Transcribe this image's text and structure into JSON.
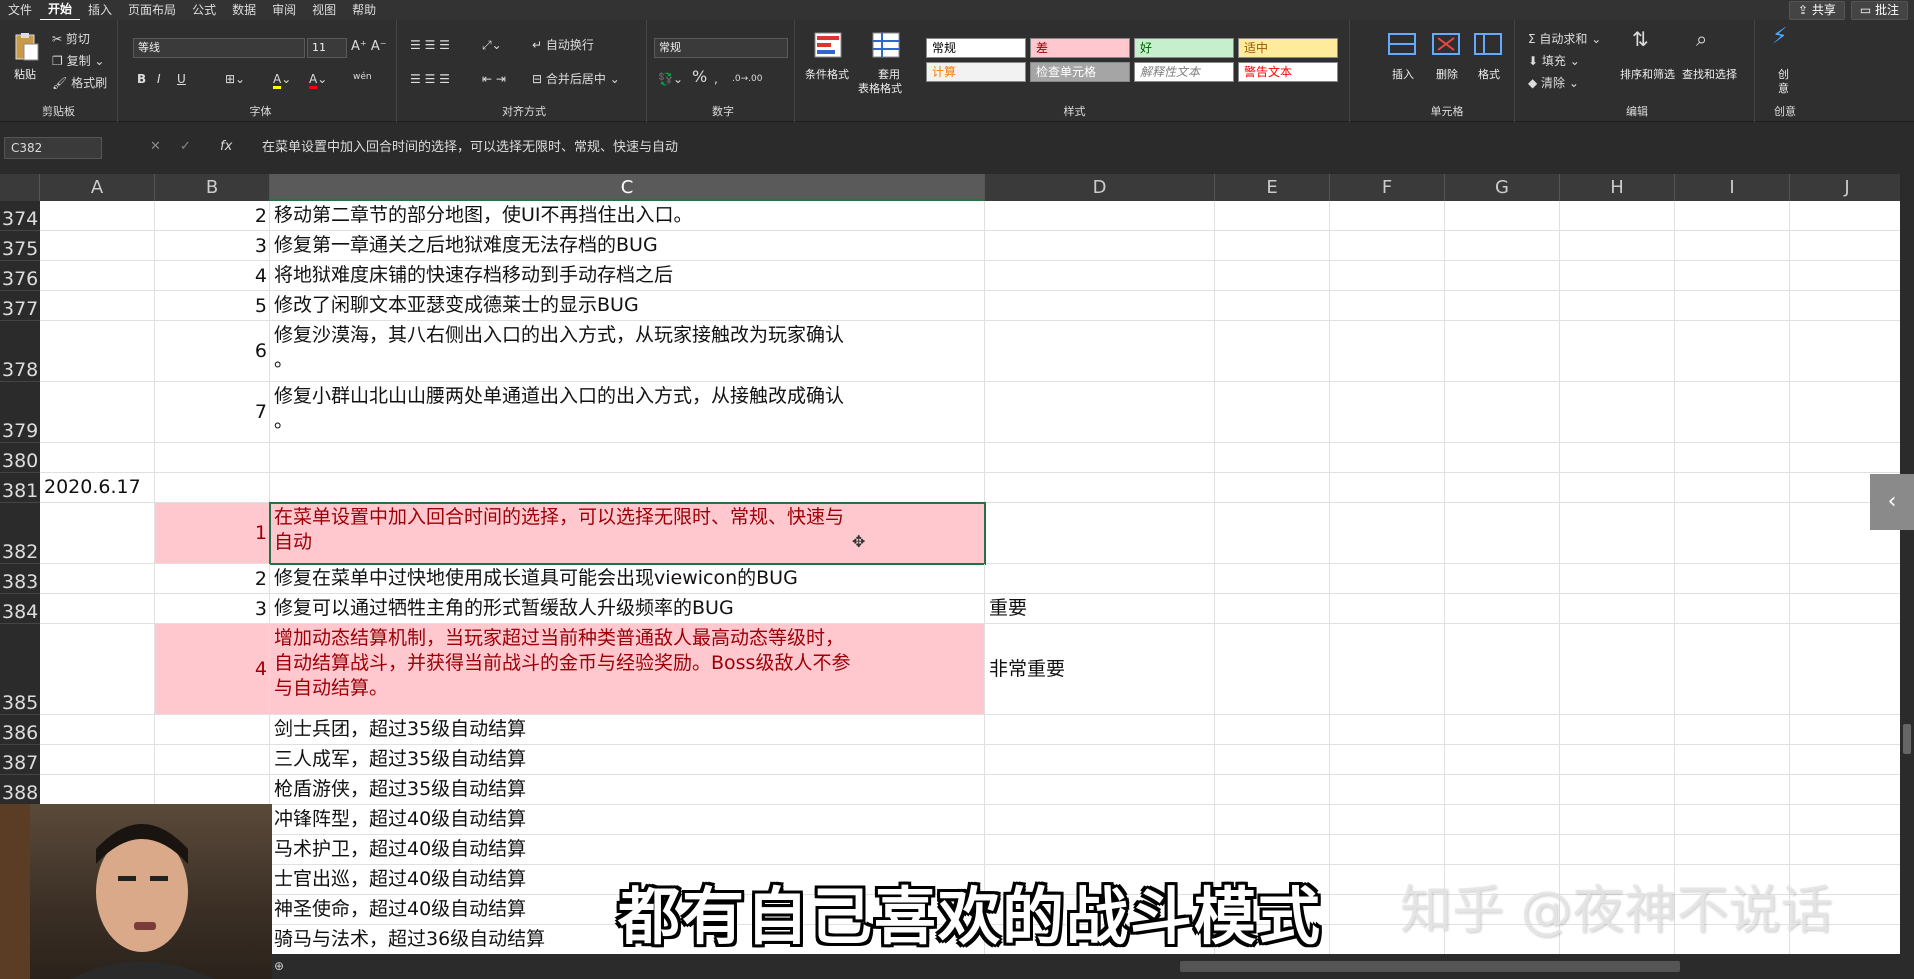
{
  "menu": {
    "tabs": [
      "文件",
      "开始",
      "插入",
      "页面布局",
      "公式",
      "数据",
      "审阅",
      "视图",
      "帮助"
    ],
    "active_index": 1,
    "share_label": "共享",
    "comments_label": "批注"
  },
  "ribbon": {
    "clipboard": {
      "paste": "粘贴",
      "cut": "剪切",
      "copy": "复制",
      "format_painter": "格式刷",
      "group": "剪贴板"
    },
    "font": {
      "name": "等线",
      "size": "11",
      "group": "字体",
      "bold": "B",
      "italic": "I",
      "underline": "U",
      "phonetic": "wén"
    },
    "alignment": {
      "wrap": "自动换行",
      "merge": "合并后居中",
      "group": "对齐方式"
    },
    "number": {
      "format": "常规",
      "percent": "%",
      "group": "数字"
    },
    "styles": {
      "conditional": "条件格式",
      "table": "套用",
      "table2": "表格格式",
      "cells": [
        {
          "label": "常规",
          "bg": "#ffffff",
          "fg": "#000000"
        },
        {
          "label": "差",
          "bg": "#ffc7ce",
          "fg": "#9c0006"
        },
        {
          "label": "好",
          "bg": "#c6efce",
          "fg": "#006100"
        },
        {
          "label": "适中",
          "bg": "#ffeb9c",
          "fg": "#9c5700"
        },
        {
          "label": "计算",
          "bg": "#f2f2f2",
          "fg": "#fa7d00"
        },
        {
          "label": "检查单元格",
          "bg": "#a5a5a5",
          "fg": "#ffffff"
        },
        {
          "label": "解释性文本",
          "bg": "#ffffff",
          "fg": "#7f7f7f"
        },
        {
          "label": "警告文本",
          "bg": "#ffffff",
          "fg": "#ff0000"
        }
      ],
      "group": "样式"
    },
    "cells": {
      "insert": "插入",
      "delete": "删除",
      "format": "格式",
      "group": "单元格"
    },
    "editing": {
      "autosum": "自动求和",
      "fill": "填充",
      "clear": "清除",
      "sort": "排序和筛选",
      "find": "查找和选择",
      "group": "编辑"
    },
    "create": {
      "label1": "创",
      "label2": "意",
      "group": "创意"
    }
  },
  "formula_bar": {
    "name_box": "C382",
    "fx": "fx",
    "content": "在菜单设置中加入回合时间的选择，可以选择无限时、常规、快速与自动"
  },
  "grid": {
    "columns": [
      "A",
      "B",
      "C",
      "D",
      "E",
      "F",
      "G",
      "H",
      "I",
      "J"
    ],
    "selected_column": "C",
    "rows": [
      {
        "num": "374",
        "a": "",
        "b": "2",
        "c": [
          "移动第二章节的部分地图，使UI不再挡住出入口。"
        ],
        "d": "",
        "pink": false
      },
      {
        "num": "375",
        "a": "",
        "b": "3",
        "c": [
          "修复第一章通关之后地狱难度无法存档的BUG"
        ],
        "d": "",
        "pink": false
      },
      {
        "num": "376",
        "a": "",
        "b": "4",
        "c": [
          "将地狱难度床铺的快速存档移动到手动存档之后"
        ],
        "d": "",
        "pink": false
      },
      {
        "num": "377",
        "a": "",
        "b": "5",
        "c": [
          "修改了闲聊文本亚瑟变成德莱士的显示BUG"
        ],
        "d": "",
        "pink": false
      },
      {
        "num": "378",
        "a": "",
        "b": "6",
        "c": [
          "修复沙漠海，其八右侧出入口的出入方式，从玩家接触改为玩家确认",
          "。"
        ],
        "d": "",
        "pink": false
      },
      {
        "num": "379",
        "a": "",
        "b": "7",
        "c": [
          "修复小群山北山山腰两处单通道出入口的出入方式，从接触改成确认",
          "。"
        ],
        "d": "",
        "pink": false
      },
      {
        "num": "380",
        "a": "",
        "b": "",
        "c": [],
        "d": "",
        "pink": false
      },
      {
        "num": "381",
        "a": "2020.6.17",
        "b": "",
        "c": [],
        "d": "",
        "pink": false
      },
      {
        "num": "382",
        "a": "",
        "b": "1",
        "c": [
          "在菜单设置中加入回合时间的选择，可以选择无限时、常规、快速与",
          "自动"
        ],
        "d": "",
        "pink": true
      },
      {
        "num": "383",
        "a": "",
        "b": "2",
        "c": [
          "修复在菜单中过快地使用成长道具可能会出现viewicon的BUG"
        ],
        "d": "",
        "pink": false
      },
      {
        "num": "384",
        "a": "",
        "b": "3",
        "c": [
          "修复可以通过牺牲主角的形式暂缓敌人升级频率的BUG"
        ],
        "d": "重要",
        "pink": false
      },
      {
        "num": "385",
        "a": "",
        "b": "4",
        "c": [
          "增加动态结算机制，当玩家超过当前种类普通敌人最高动态等级时，",
          "自动结算战斗，并获得当前战斗的金币与经验奖励。Boss级敌人不参",
          "与自动结算。"
        ],
        "d": "非常重要",
        "pink": true
      },
      {
        "num": "386",
        "a": "",
        "b": "",
        "c": [
          "剑士兵团，超过35级自动结算"
        ],
        "d": "",
        "pink": false
      },
      {
        "num": "387",
        "a": "",
        "b": "",
        "c": [
          "三人成军，超过35级自动结算"
        ],
        "d": "",
        "pink": false
      },
      {
        "num": "388",
        "a": "",
        "b": "",
        "c": [
          "枪盾游侠，超过35级自动结算"
        ],
        "d": "",
        "pink": false
      },
      {
        "num": "389",
        "a": "",
        "b": "",
        "c": [
          "冲锋阵型，超过40级自动结算"
        ],
        "d": "",
        "pink": false
      },
      {
        "num": "390",
        "a": "",
        "b": "",
        "c": [
          "马术护卫，超过40级自动结算"
        ],
        "d": "",
        "pink": false
      },
      {
        "num": "391",
        "a": "",
        "b": "",
        "c": [
          "士官出巡，超过40级自动结算"
        ],
        "d": "",
        "pink": false
      },
      {
        "num": "392",
        "a": "",
        "b": "",
        "c": [
          "神圣使命，超过40级自动结算"
        ],
        "d": "",
        "pink": false
      },
      {
        "num": "393",
        "a": "",
        "b": "",
        "c": [
          "骑马与法术，超过36级自动结算"
        ],
        "d": "",
        "pink": false
      }
    ]
  },
  "overlay": {
    "subtitle": "都有自己喜欢的战斗模式",
    "watermark": "知乎 @夜神不说话"
  }
}
